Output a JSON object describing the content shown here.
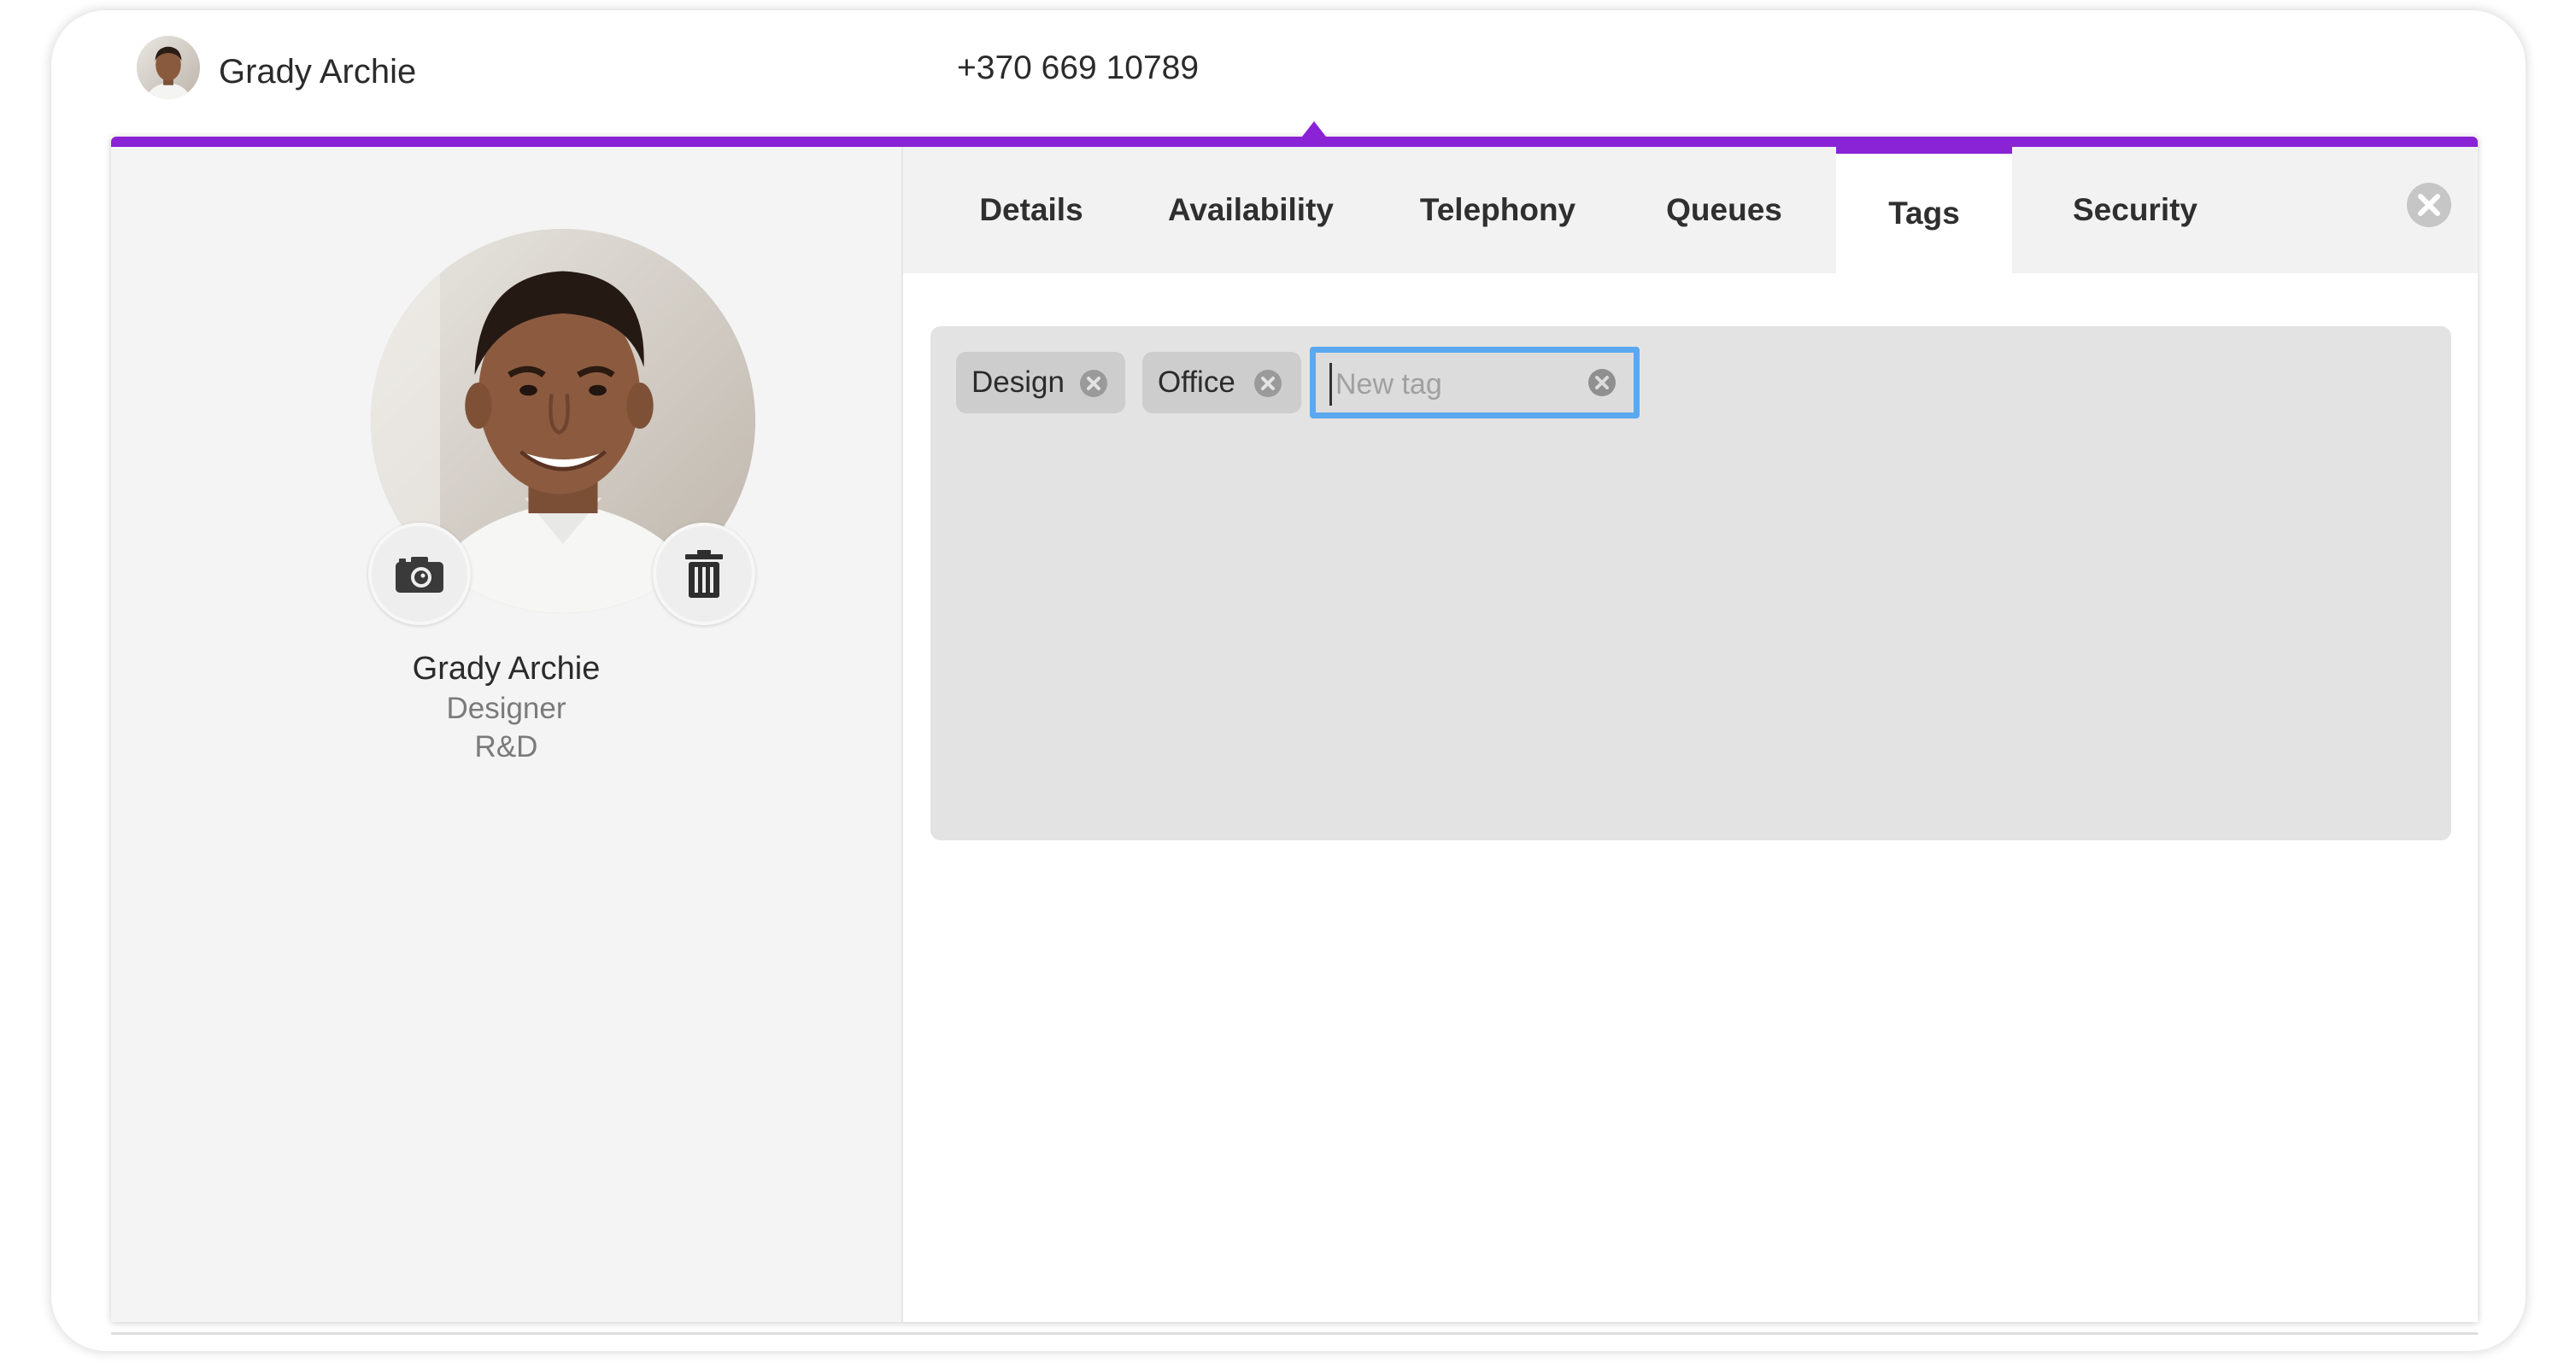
{
  "header": {
    "name": "Grady Archie",
    "phone": "+370 669 10789"
  },
  "profile": {
    "name": "Grady Archie",
    "role": "Designer",
    "department": "R&D"
  },
  "tabs": [
    {
      "label": "Details",
      "active": false
    },
    {
      "label": "Availability",
      "active": false
    },
    {
      "label": "Telephony",
      "active": false
    },
    {
      "label": "Queues",
      "active": false
    },
    {
      "label": "Tags",
      "active": true
    },
    {
      "label": "Security",
      "active": false
    }
  ],
  "tags": [
    {
      "label": "Design"
    },
    {
      "label": "Office"
    }
  ],
  "new_tag": {
    "placeholder": "New tag",
    "value": ""
  },
  "icons": {
    "avatar_upload": "camera-icon",
    "avatar_delete": "trash-icon",
    "tag_remove": "close-circle-icon",
    "panel_close": "close-circle-icon"
  },
  "colors": {
    "accent": "#8a22d6",
    "focus": "#5aa8f0"
  }
}
